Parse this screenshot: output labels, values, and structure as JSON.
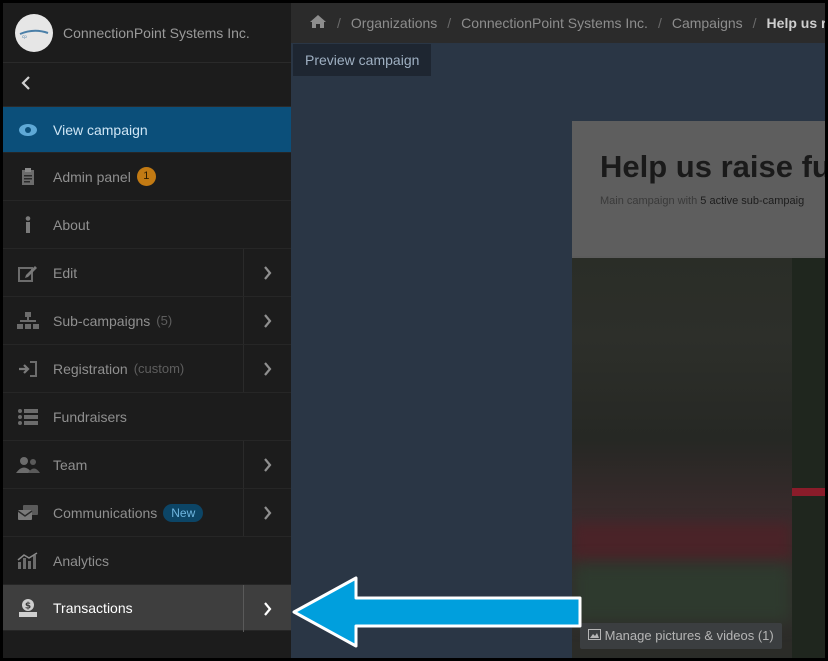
{
  "org": {
    "name": "ConnectionPoint Systems Inc."
  },
  "nav": {
    "collapse_icon": "chevron-left-icon",
    "items": [
      {
        "key": "view-campaign",
        "label": "View campaign",
        "icon": "eye-icon"
      },
      {
        "key": "admin-panel",
        "label": "Admin panel",
        "icon": "clipboard-icon",
        "badge": "1"
      },
      {
        "key": "about",
        "label": "About",
        "icon": "info-icon"
      },
      {
        "key": "edit",
        "label": "Edit",
        "icon": "edit-icon"
      },
      {
        "key": "sub-campaigns",
        "label": "Sub-campaigns",
        "icon": "hierarchy-icon",
        "extra": "(5)"
      },
      {
        "key": "registration",
        "label": "Registration",
        "icon": "sign-in-icon",
        "extra": "(custom)"
      },
      {
        "key": "fundraisers",
        "label": "Fundraisers",
        "icon": "list-icon"
      },
      {
        "key": "team",
        "label": "Team",
        "icon": "users-icon"
      },
      {
        "key": "communications",
        "label": "Communications",
        "icon": "messages-icon",
        "tag": "New"
      },
      {
        "key": "analytics",
        "label": "Analytics",
        "icon": "chart-icon"
      },
      {
        "key": "transactions",
        "label": "Transactions",
        "icon": "money-icon"
      }
    ]
  },
  "breadcrumb": {
    "home_icon": "home-icon",
    "items": [
      "Organizations",
      "ConnectionPoint Systems Inc.",
      "Campaigns"
    ],
    "current": "Help us raise"
  },
  "preview_tab": "Preview campaign",
  "campaign": {
    "title": "Help us raise fu",
    "sub_prefix": "Main campaign with",
    "sub_link": "5 active sub-campaig",
    "manage_media": "Manage pictures & videos (1)"
  },
  "colors": {
    "active": "#0b4f7a",
    "badge": "#c27a13",
    "arrow": "#009fdd"
  }
}
